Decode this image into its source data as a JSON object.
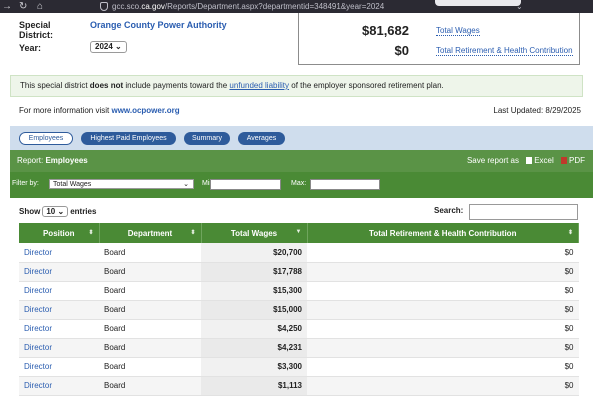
{
  "browser": {
    "url_prefix": "gcc.sco.",
    "url_domain": "ca.gov",
    "url_path": "/Reports/Department.aspx?departmentid=348491&year=2024"
  },
  "district": {
    "label": "Special District:",
    "name": "Orange County Power Authority",
    "year_label": "Year:",
    "year_value": "2024"
  },
  "totals": {
    "wages_amount": "$81,682",
    "wages_link": "Total Wages",
    "retirement_amount": "$0",
    "retirement_link": "Total Retirement & Health Contribution"
  },
  "notice": {
    "part1": "This special district ",
    "bold": "does not",
    "part2": " include payments toward the ",
    "link": "unfunded liability",
    "part3": " of the employer sponsored retirement plan."
  },
  "info": {
    "more_prefix": "For more information visit ",
    "website": "www.ocpower.org",
    "last_updated": "Last Updated: 8/29/2025"
  },
  "tabs": [
    {
      "label": "Employees",
      "active": true
    },
    {
      "label": "Highest Paid Employees",
      "active": false
    },
    {
      "label": "Summary",
      "active": false
    },
    {
      "label": "Averages",
      "active": false
    }
  ],
  "report": {
    "prefix": "Report: ",
    "name": "Employees",
    "save_label": "Save report as",
    "excel": "Excel",
    "pdf": "PDF"
  },
  "filter": {
    "label": "Filter by:",
    "selected": "Total Wages",
    "min_label": "Min:",
    "max_label": "Max:"
  },
  "table_controls": {
    "show_label": "Show",
    "entries_value": "10",
    "entries_label": "entries",
    "search_label": "Search:"
  },
  "table": {
    "columns": [
      "Position",
      "Department",
      "Total Wages",
      "Total Retirement & Health Contribution"
    ],
    "rows": [
      [
        "Director",
        "Board",
        "$20,700",
        "$0"
      ],
      [
        "Director",
        "Board",
        "$17,788",
        "$0"
      ],
      [
        "Director",
        "Board",
        "$15,300",
        "$0"
      ],
      [
        "Director",
        "Board",
        "$15,000",
        "$0"
      ],
      [
        "Director",
        "Board",
        "$4,250",
        "$0"
      ],
      [
        "Director",
        "Board",
        "$4,231",
        "$0"
      ],
      [
        "Director",
        "Board",
        "$3,300",
        "$0"
      ],
      [
        "Director",
        "Board",
        "$1,113",
        "$0"
      ]
    ]
  }
}
